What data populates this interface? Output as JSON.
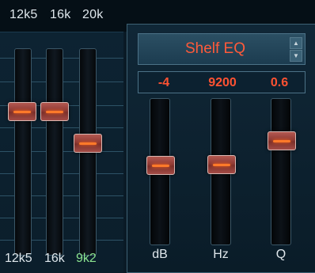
{
  "top_labels": [
    "12k5",
    "16k",
    "20k"
  ],
  "graphic_eq": {
    "bands": [
      {
        "label": "12k5",
        "label_color": "#dfe7ec"
      },
      {
        "label": "16k",
        "label_color": "#dfe7ec"
      },
      {
        "label": "9k2",
        "label_color": "#8be38f"
      }
    ]
  },
  "shelf_eq": {
    "type_label": "Shelf EQ",
    "values": {
      "db": "-4",
      "hz": "9200",
      "q": "0.6"
    },
    "params": [
      {
        "label": "dB"
      },
      {
        "label": "Hz"
      },
      {
        "label": "Q"
      }
    ]
  },
  "colors": {
    "accent": "#ff5a3a",
    "knob_line": "#ff7a2a",
    "highlight_label": "#8be38f",
    "panel_border": "#3d6174"
  },
  "icons": {
    "spin_up": "caret-up",
    "spin_down": "caret-down"
  }
}
